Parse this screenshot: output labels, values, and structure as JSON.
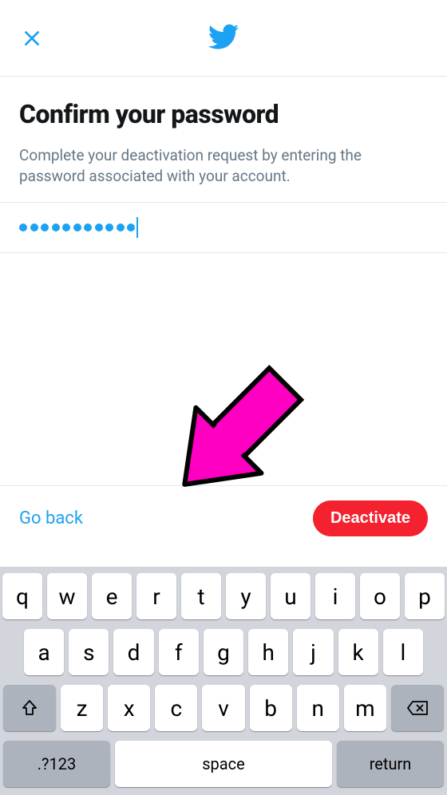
{
  "header": {
    "title": "Confirm your password",
    "subtitle": "Complete your deactivation request by entering the password associated with your account."
  },
  "password": {
    "dot_count": 11
  },
  "actions": {
    "back_label": "Go back",
    "deactivate_label": "Deactivate"
  },
  "keyboard": {
    "row1": [
      "q",
      "w",
      "e",
      "r",
      "t",
      "y",
      "u",
      "i",
      "o",
      "p"
    ],
    "row2": [
      "a",
      "s",
      "d",
      "f",
      "g",
      "h",
      "j",
      "k",
      "l"
    ],
    "row3": [
      "z",
      "x",
      "c",
      "v",
      "b",
      "n",
      "m"
    ],
    "nums_label": ".?123",
    "space_label": "space",
    "return_label": "return"
  }
}
